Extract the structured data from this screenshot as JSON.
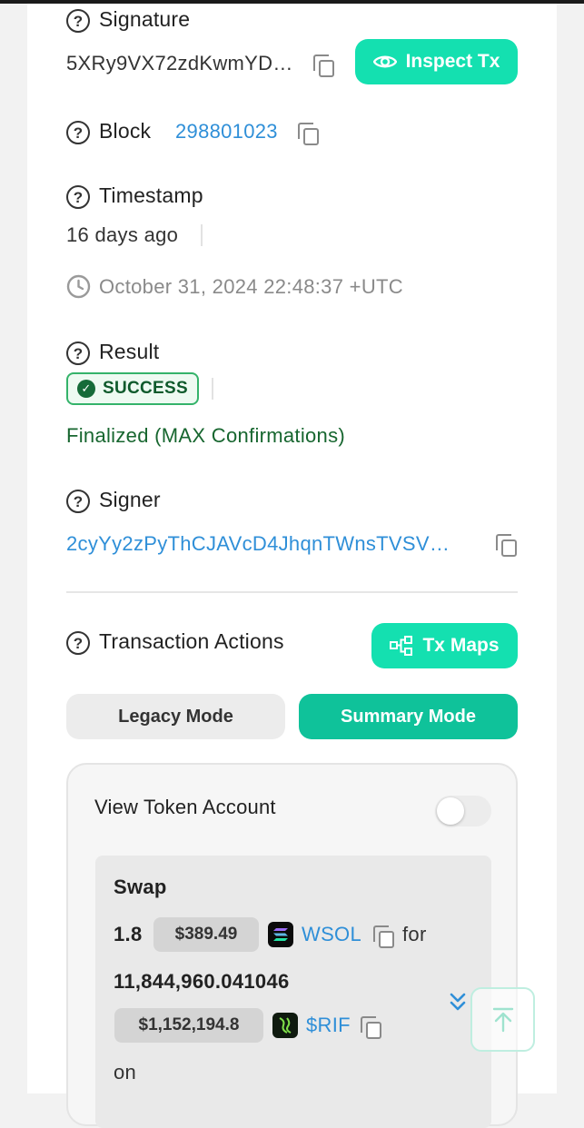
{
  "signature": {
    "label": "Signature",
    "value": "5XRy9VX72zdKwmYD…",
    "inspect_button": "Inspect Tx"
  },
  "block": {
    "label": "Block",
    "value": "298801023"
  },
  "timestamp": {
    "label": "Timestamp",
    "relative": "16 days ago",
    "absolute": "October 31, 2024 22:48:37 +UTC"
  },
  "result": {
    "label": "Result",
    "badge": "SUCCESS",
    "finality": "Finalized (MAX Confirmations)"
  },
  "signer": {
    "label": "Signer",
    "value": "2cyYy2zPyThCJAVcD4JhqnTWnsTVSV…"
  },
  "actions": {
    "label": "Transaction Actions",
    "tx_maps_button": "Tx Maps",
    "legacy_mode": "Legacy Mode",
    "summary_mode": "Summary Mode",
    "view_token_account": "View Token Account",
    "view_token_account_enabled": false
  },
  "swap": {
    "title": "Swap",
    "amount_in": "1.8",
    "amount_in_usd": "$389.49",
    "token_in": "WSOL",
    "for_text": "for",
    "amount_out": "11,844,960.041046",
    "amount_out_usd": "$1,152,194.8",
    "token_out": "$RIF",
    "on_text": "on"
  },
  "colors": {
    "accent_green": "#14e0b0",
    "summary_green": "#0fc29a",
    "link_blue": "#2f8fd8",
    "success_green": "#166b39"
  },
  "icons": {
    "help": "question-circle-icon",
    "copy": "copy-icon",
    "eye": "eye-icon",
    "clock": "clock-icon",
    "check": "check-circle-icon",
    "tx_maps": "flow-chart-icon",
    "expand": "double-chevron-down-icon",
    "scroll_top": "arrow-up-to-line-icon"
  }
}
